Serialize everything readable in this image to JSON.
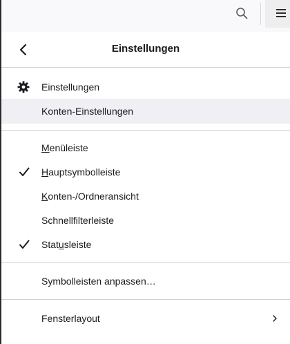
{
  "toolbar": {
    "search_icon": "search-icon",
    "menu_icon": "hamburger-menu-icon"
  },
  "panel": {
    "title": "Einstellungen",
    "back_icon": "chevron-left-icon",
    "settings_section": [
      {
        "label": "Einstellungen",
        "icon": "gear-icon"
      },
      {
        "label": "Konten-Einstellungen",
        "hovered": true
      }
    ],
    "toolbars_section": [
      {
        "label_pre": "",
        "accesskey": "M",
        "label_post": "enüleiste",
        "checked": false
      },
      {
        "label_pre": "",
        "accesskey": "H",
        "label_post": "auptsymbolleiste",
        "checked": true
      },
      {
        "label_pre": "",
        "accesskey": "K",
        "label_post": "onten-/Ordneransicht",
        "checked": false
      },
      {
        "label_pre": "Schnellfilterleiste",
        "accesskey": "",
        "label_post": "",
        "checked": false
      },
      {
        "label_pre": "Stat",
        "accesskey": "u",
        "label_post": "sleiste",
        "checked": true
      }
    ],
    "customize_label": "Symbolleisten anpassen…",
    "window_layout_label": "Fensterlayout",
    "window_layout_icon": "chevron-right-icon"
  },
  "colors": {
    "toolbar_bg": "#f9f9fb",
    "hover_bg": "#f0f0f4",
    "text": "#1b1b1f",
    "separator": "#cfcfd8"
  }
}
